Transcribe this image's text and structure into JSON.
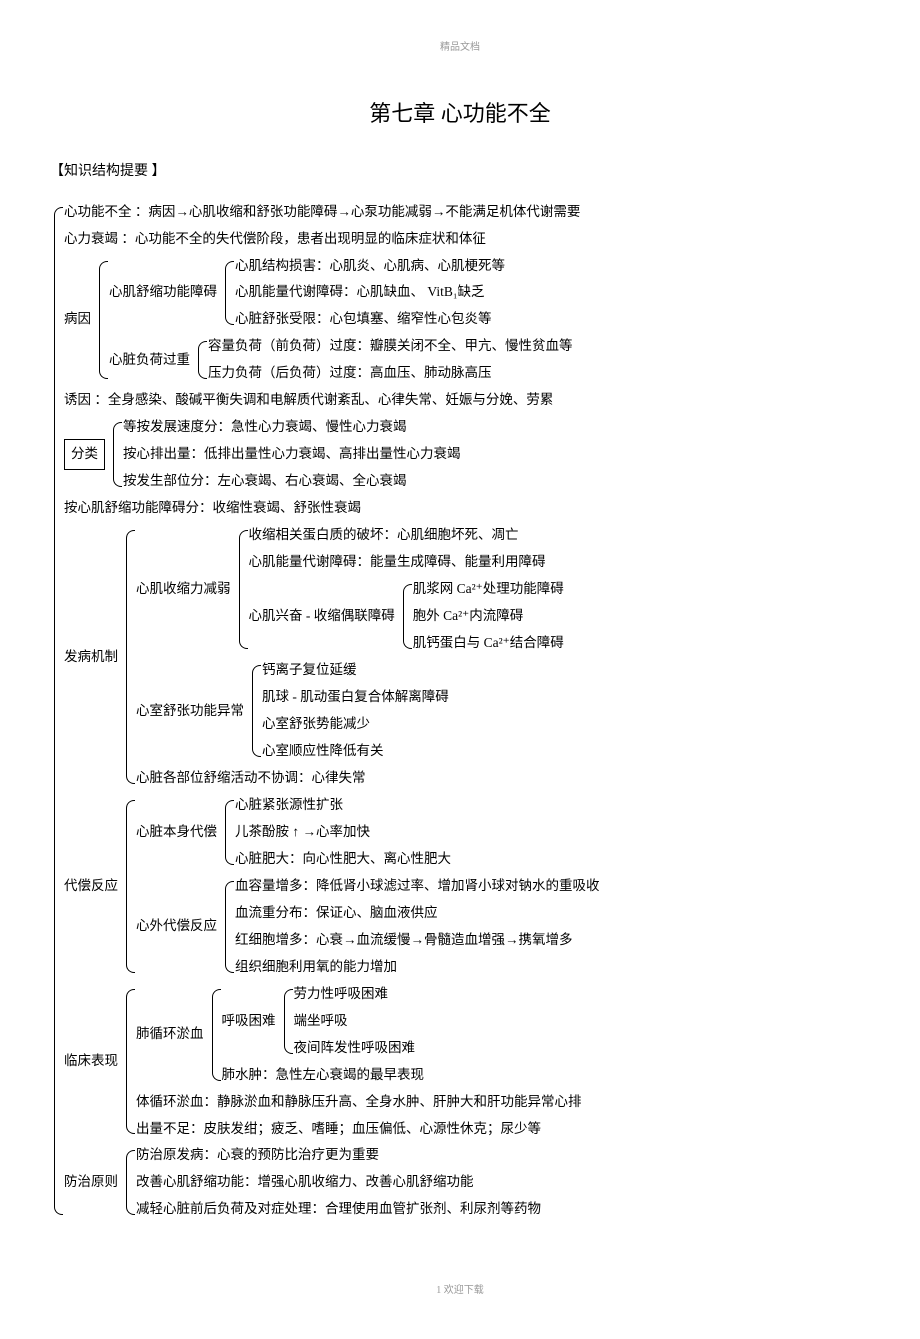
{
  "header": "精品文档",
  "title": "第七章 心功能不全",
  "section_label": "【知识结构提要 】",
  "footer": "1 欢迎下载",
  "defs": {
    "l1": "心功能不全 ：病因→心肌收缩和舒张功能障碍→心泵功能减弱→不能满足机体代谢需要",
    "l2": "心力衰竭 ：心功能不全的失代偿阶段，患者出现明显的临床症状和体征"
  },
  "cause": {
    "label": "病因",
    "a": {
      "label": "心肌舒缩功能障碍",
      "items": [
        "心肌结构损害：心肌炎、心肌病、心肌梗死等",
        "心肌能量代谢障碍：心肌缺血、 VitB₁缺乏",
        "心脏舒张受限：心包填塞、缩窄性心包炎等"
      ]
    },
    "b": {
      "label": "心脏负荷过重",
      "items": [
        "容量负荷（前负荷）过度：瓣膜关闭不全、甲亢、慢性贫血等",
        "压力负荷（后负荷）过度：高血压、肺动脉高压"
      ]
    }
  },
  "trigger": "诱因 ：全身感染、酸碱平衡失调和电解质代谢紊乱、心律失常、妊娠与分娩、劳累",
  "classify": {
    "label": "分类",
    "items": [
      "等按发展速度分：急性心力衰竭、慢性心力衰竭",
      "按心排出量：低排出量性心力衰竭、高排出量性心力衰竭",
      "按发生部位分：左心衰竭、右心衰竭、全心衰竭"
    ]
  },
  "classify_extra": "按心肌舒缩功能障碍分：收缩性衰竭、舒张性衰竭",
  "mech": {
    "label": "发病机制",
    "a": {
      "label": "心肌收缩力减弱",
      "i1": "收缩相关蛋白质的破坏：心肌细胞坏死、凋亡",
      "i2": "心肌能量代谢障碍：能量生成障碍、能量利用障碍",
      "i3": {
        "label": "心肌兴奋 - 收缩偶联障碍",
        "items": [
          "肌浆网 Ca²⁺处理功能障碍",
          "胞外 Ca²⁺内流障碍",
          "肌钙蛋白与 Ca²⁺结合障碍"
        ]
      }
    },
    "b": {
      "label": "心室舒张功能异常",
      "items": [
        "钙离子复位延缓",
        "肌球 - 肌动蛋白复合体解离障碍",
        "心室舒张势能减少",
        "心室顺应性降低有关"
      ]
    },
    "c": "心脏各部位舒缩活动不协调：心律失常"
  },
  "comp": {
    "label": "代偿反应",
    "a": {
      "label": "心脏本身代偿",
      "items": [
        "心脏紧张源性扩张",
        "儿茶酚胺 ↑ →心率加快",
        "心脏肥大：向心性肥大、离心性肥大"
      ]
    },
    "b": {
      "label": "心外代偿反应",
      "items": [
        "血容量增多：降低肾小球滤过率、增加肾小球对钠水的重吸收",
        "血流重分布：保证心、脑血液供应",
        "红细胞增多：心衰→血流缓慢→骨髓造血增强→携氧增多",
        "组织细胞利用氧的能力增加"
      ]
    }
  },
  "clin": {
    "label": "临床表现",
    "a": {
      "label": "肺循环淤血",
      "dys": {
        "label": "呼吸困难",
        "items": [
          "劳力性呼吸困难",
          "端坐呼吸",
          "夜间阵发性呼吸困难"
        ]
      },
      "edema": "肺水肿：急性左心衰竭的最早表现"
    },
    "b": "体循环淤血：静脉淤血和静脉压升高、全身水肿、肝肿大和肝功能异常心排",
    "c": "出量不足：皮肤发绀；疲乏、嗜睡；血压偏低、心源性休克；尿少等"
  },
  "treat": {
    "label": "防治原则",
    "items": [
      "防治原发病：心衰的预防比治疗更为重要",
      "改善心肌舒缩功能：增强心肌收缩力、改善心肌舒缩功能",
      "减轻心脏前后负荷及对症处理：合理使用血管扩张剂、利尿剂等药物"
    ]
  }
}
